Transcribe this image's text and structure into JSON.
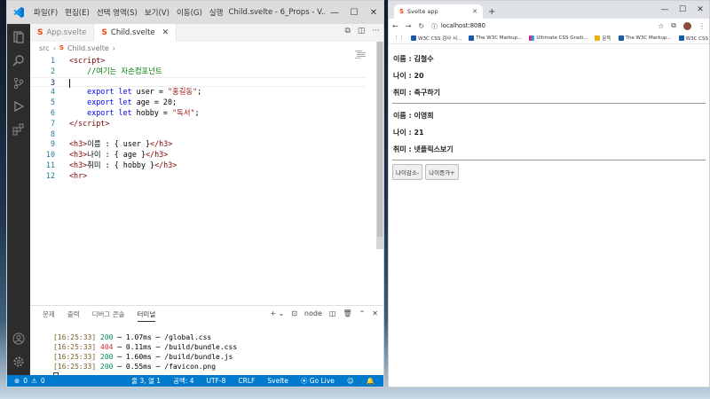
{
  "vscode": {
    "menu": [
      "파일(F)",
      "편집(E)",
      "선택 영역(S)",
      "보기(V)",
      "이동(G)",
      "실행"
    ],
    "title": "Child.svelte - 6_Props - V...",
    "tabs": [
      {
        "label": "App.svelte"
      },
      {
        "label": "Child.svelte"
      }
    ],
    "breadcrumb": [
      "src",
      "Child.svelte"
    ],
    "code_lines": [
      {
        "n": "1",
        "html": "<span class='t-tag'>&lt;script&gt;</span>"
      },
      {
        "n": "2",
        "html": "    <span class='t-com'>//여기는 자손컴포넌트</span>"
      },
      {
        "n": "3",
        "html": ""
      },
      {
        "n": "4",
        "html": "    <span class='t-kw'>export</span> <span class='t-kw'>let</span> <span class='t-txt'>user = </span><span class='t-str'>\"홍길동\"</span><span class='t-txt'>;</span>"
      },
      {
        "n": "5",
        "html": "    <span class='t-kw'>export</span> <span class='t-kw'>let</span> <span class='t-txt'>age = 20;</span>"
      },
      {
        "n": "6",
        "html": "    <span class='t-kw'>export</span> <span class='t-kw'>let</span> <span class='t-txt'>hobby = </span><span class='t-str'>\"독서\"</span><span class='t-txt'>;</span>"
      },
      {
        "n": "7",
        "html": "<span class='t-tag'>&lt;/script&gt;</span>"
      },
      {
        "n": "8",
        "html": ""
      },
      {
        "n": "9",
        "html": "<span class='t-tag'>&lt;h3&gt;</span><span class='t-txt'>이름 : { user }</span><span class='t-tag'>&lt;/h3&gt;</span>"
      },
      {
        "n": "10",
        "html": "<span class='t-tag'>&lt;h3&gt;</span><span class='t-txt'>나이 : { age }</span><span class='t-tag'>&lt;/h3&gt;</span>"
      },
      {
        "n": "11",
        "html": "<span class='t-tag'>&lt;h3&gt;</span><span class='t-txt'>취미 : { hobby }</span><span class='t-tag'>&lt;/h3&gt;</span>"
      },
      {
        "n": "12",
        "html": "<span class='t-tag'>&lt;hr&gt;</span>"
      }
    ],
    "current_line": 3,
    "panel": {
      "tabs": [
        "문제",
        "출력",
        "디버그 콘솔",
        "터미널"
      ],
      "active_tab": "터미널",
      "terminal_name": "node",
      "lines": [
        {
          "ts": "[16:25:33]",
          "code": "200",
          "rest": " ─ 1.07ms ─ /global.css"
        },
        {
          "ts": "[16:25:33]",
          "code": "404",
          "rest": " ─ 0.11ms ─ /build/bundle.css"
        },
        {
          "ts": "[16:25:33]",
          "code": "200",
          "rest": " ─ 1.60ms ─ /build/bundle.js"
        },
        {
          "ts": "[16:25:33]",
          "code": "200",
          "rest": " ─ 0.55ms ─ /favicon.png"
        }
      ]
    },
    "status": {
      "errors": "0",
      "warnings": "0",
      "position": "줄 3, 열 1",
      "spaces": "공백: 4",
      "encoding": "UTF-8",
      "eol": "CRLF",
      "language": "Svelte",
      "golive": "Go Live"
    },
    "colors": {
      "statusbar": "#007acc",
      "activitybar": "#2c2c2c",
      "svelte": "#ff3e00"
    }
  },
  "browser": {
    "tab_title": "Svelte app",
    "url": "localhost:8080",
    "bookmarks": [
      "W3C CSS 검사 서...",
      "The W3C Markup...",
      "Ultimate CSS Gradi...",
      "문득",
      "The W3C Markup...",
      "W3C CSS 검사 서..."
    ],
    "page": {
      "first": {
        "name": "이름 : 김철수",
        "age": "나이 : 20",
        "hobby": "취미 : 축구하기"
      },
      "second": {
        "name": "이름 : 이영희",
        "age": "나이 : 21",
        "hobby": "취미 : 넷플릭스보기"
      },
      "buttons": [
        "나이감소-",
        "나이증가+"
      ]
    }
  }
}
